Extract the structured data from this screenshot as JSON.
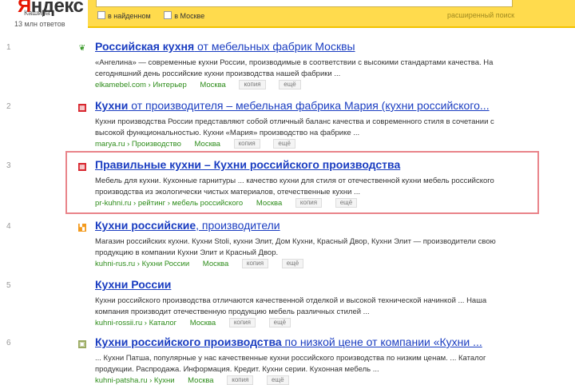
{
  "header": {
    "logo_first": "Я",
    "logo_rest": "ндекс",
    "region": "Кашира",
    "found": "13 млн ответов",
    "filter_region_label": "в найденном",
    "filter_city_label": "в Москве",
    "ext_search": "расширенный поиск"
  },
  "results": [
    {
      "num": "1",
      "title_bold": "Российская кухня",
      "title_rest": " от мебельных фабрик Москвы",
      "snippet": "«Ангелина» — современные кухни России, производимые в соответствии с высокими стандартами качества. На сегодняшний день российские кухни производства нашей фабрики ...",
      "url": "elkamebel.com › Интерьер",
      "city": "Москва",
      "btn1": "копия",
      "btn2": "ещё",
      "favicon_color": "#3a9a2a"
    },
    {
      "num": "2",
      "title_bold": "Кухни",
      "title_rest": " от производителя – мебельная фабрика Мария (кухни российского...",
      "snippet": "Кухни производства России представляют собой отличный баланс качества и современного стиля в сочетании с высокой функциональностью. Кухни «Мария» производство на фабрике ...",
      "url": "marya.ru › Производство",
      "city": "Москва",
      "btn1": "копия",
      "btn2": "ещё",
      "favicon_color": "#d8262e"
    },
    {
      "num": "3",
      "title_bold": "Правильные кухни – Кухни российского производства",
      "title_rest": "",
      "snippet": "Мебель для кухни. Кухонные гарнитуры ... качество кухни для стиля от отечественной кухни мебель российского производства из экологически чистых материалов, отечественные кухни ...",
      "url": "pr-kuhni.ru › рейтинг › мебель российского",
      "city": "Москва",
      "btn1": "копия",
      "btn2": "ещё",
      "favicon_color": "#d8262e"
    },
    {
      "num": "4",
      "title_bold": "Кухни российские",
      "title_rest": ", производители",
      "snippet": "Магазин российских кухни. Кухни Stoli, кухни Элит, Дом Кухни, Красный Двор, Кухни Элит — производители свою продукцию в компании Кухни Элит и Красный Двор.",
      "url": "kuhni-rus.ru › Кухни России",
      "city": "Москва",
      "btn1": "копия",
      "btn2": "ещё",
      "favicon_color": "#f39a1d"
    },
    {
      "num": "5",
      "title_bold": "Кухни России",
      "title_rest": "",
      "snippet": "Кухни российского производства отличаются качественной отделкой и высокой технической начинкой ... Наша компания производит отечественную продукцию мебель различных стилей ...",
      "url": "kuhni-rossii.ru › Каталог",
      "city": "Москва",
      "btn1": "копия",
      "btn2": "ещё",
      "favicon_color": "#1a3dc1"
    },
    {
      "num": "6",
      "title_bold": "Кухни российского производства",
      "title_rest": " по низкой цене от компании «Кухни ...",
      "snippet": "... Кухни Патша, популярные у нас качественные кухни российского производства по низким ценам. ... Каталог продукции. Распродажа. Информация. Кредит. Кухни серии. Кухонная мебель ...",
      "url": "kuhni-patsha.ru › Кухни",
      "city": "Москва",
      "btn1": "копия",
      "btn2": "ещё",
      "favicon_color": "#6b8e23"
    }
  ]
}
